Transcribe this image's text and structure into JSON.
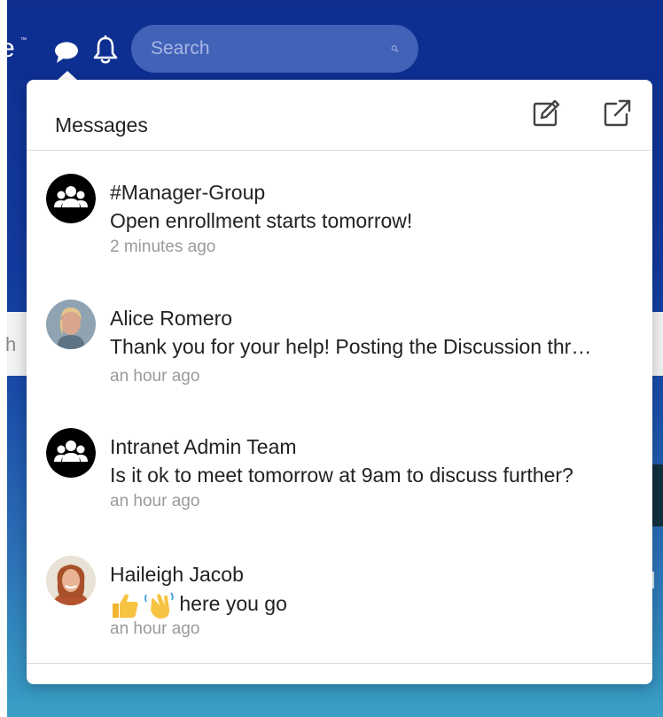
{
  "header": {
    "brand_fragment": "e",
    "brand_tm": "™",
    "search_placeholder": "Search"
  },
  "background": {
    "strip_letter": "h",
    "right_letter": "l"
  },
  "popover": {
    "title": "Messages",
    "compose_icon": "compose-icon",
    "popout_icon": "external-link-icon",
    "messages": [
      {
        "name": "#Manager-Group",
        "text": "Open enrollment starts tomorrow!",
        "time": "2 minutes ago",
        "avatar": "group-icon"
      },
      {
        "name": "Alice Romero",
        "text": "Thank you for your help! Posting the Discussion thr…",
        "time": "an hour ago",
        "avatar": "user-photo"
      },
      {
        "name": "Intranet Admin Team",
        "text": "Is it ok to meet tomorrow at 9am to discuss further?",
        "time": "an hour ago",
        "avatar": "group-icon"
      },
      {
        "name": "Haileigh Jacob",
        "text": "here you go",
        "time": "an hour ago",
        "avatar": "user-photo",
        "emojis": [
          "thumbs-up",
          "waving-hand"
        ]
      }
    ]
  },
  "colors": {
    "topbar": "#0d2f92",
    "search_bg": "#4262b8",
    "text_primary": "#222222",
    "text_muted": "#9a9a9a"
  }
}
